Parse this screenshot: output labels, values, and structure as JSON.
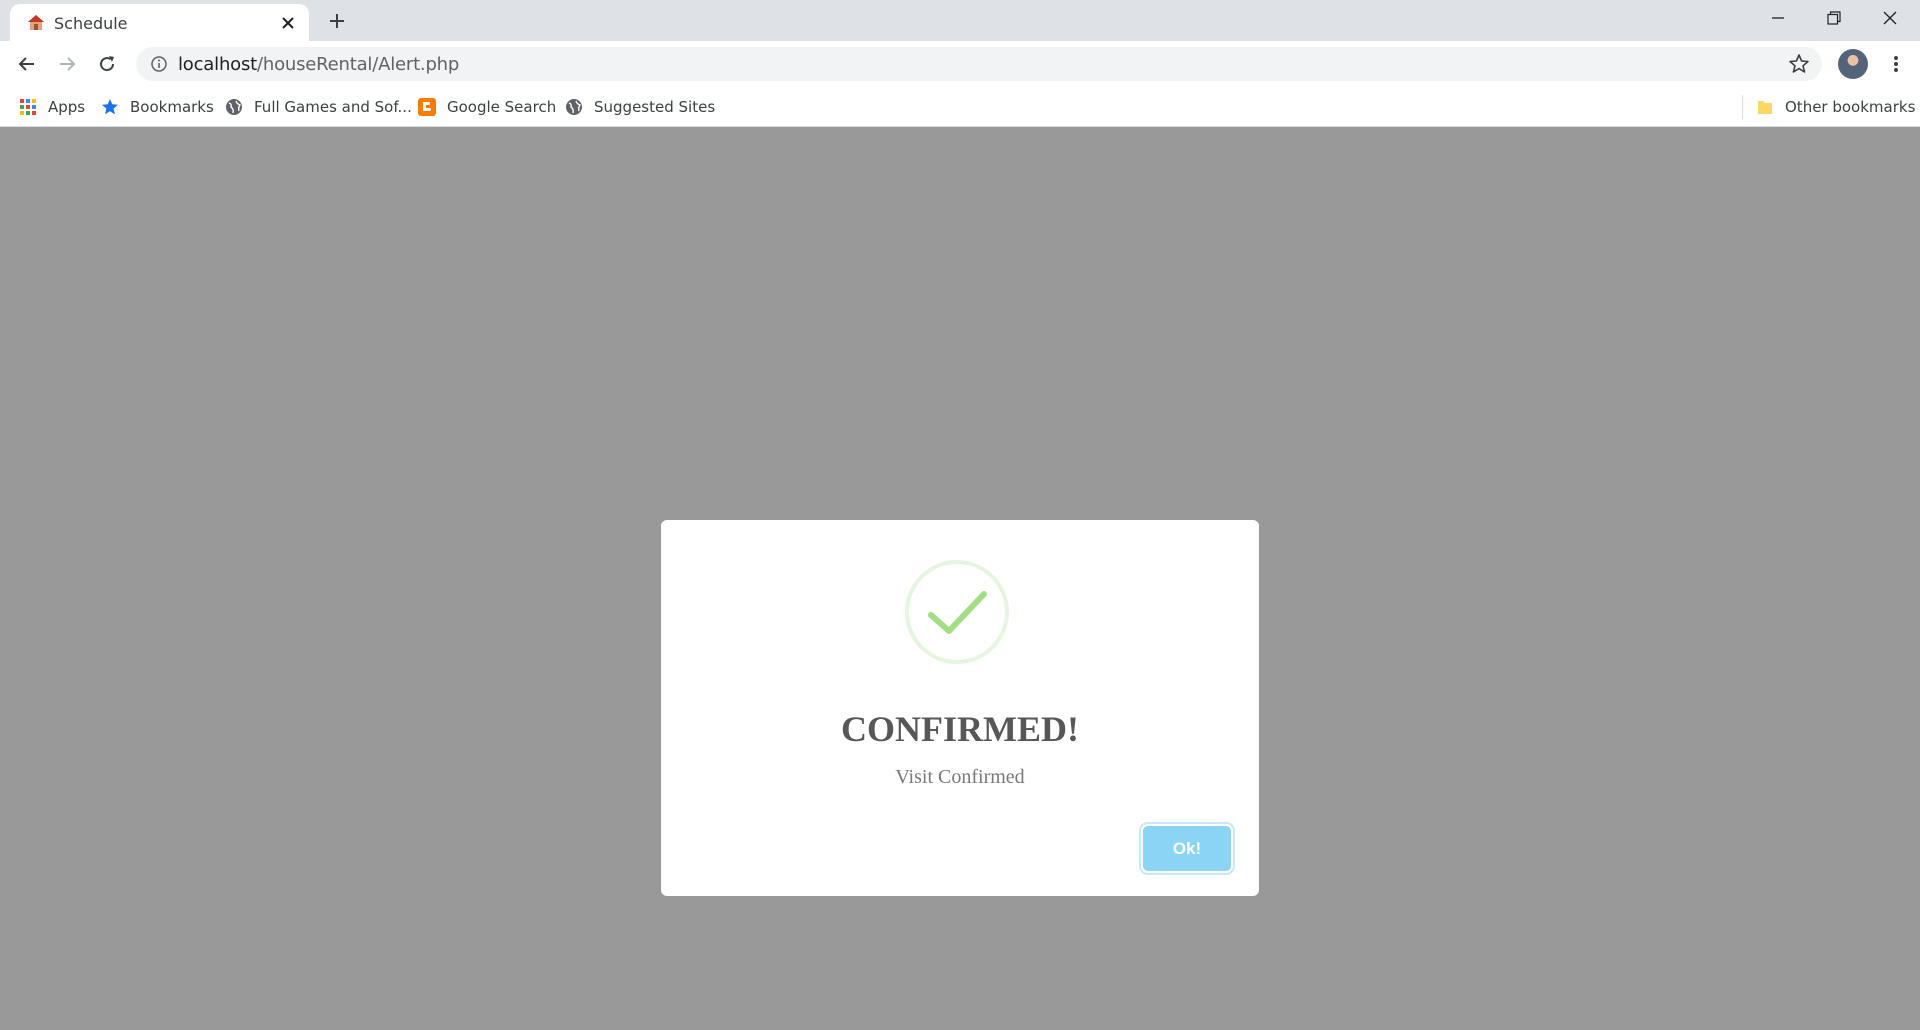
{
  "browser": {
    "tab": {
      "title": "Schedule",
      "favicon": "house-icon"
    },
    "url": {
      "host": "localhost",
      "path": "/houseRental/Alert.php"
    },
    "bookmarks": [
      {
        "label": "Apps",
        "icon": "apps-grid-icon"
      },
      {
        "label": "Bookmarks",
        "icon": "star-icon"
      },
      {
        "label": "Full Games and Sof...",
        "icon": "globe-icon"
      },
      {
        "label": "Google Search",
        "icon": "blogger-icon"
      },
      {
        "label": "Suggested Sites",
        "icon": "globe-icon"
      }
    ],
    "other_bookmarks": {
      "label": "Other bookmarks",
      "icon": "folder-icon"
    }
  },
  "alert": {
    "icon": "success-check-icon",
    "title": "CONFIRMED!",
    "text": "Visit Confirmed",
    "button_label": "Ok!"
  },
  "colors": {
    "overlay": "#999999",
    "check": "#a5dc86",
    "check_ring": "#e6f5df",
    "button": "#8cd4f5",
    "title": "#575757",
    "text": "#797979"
  }
}
